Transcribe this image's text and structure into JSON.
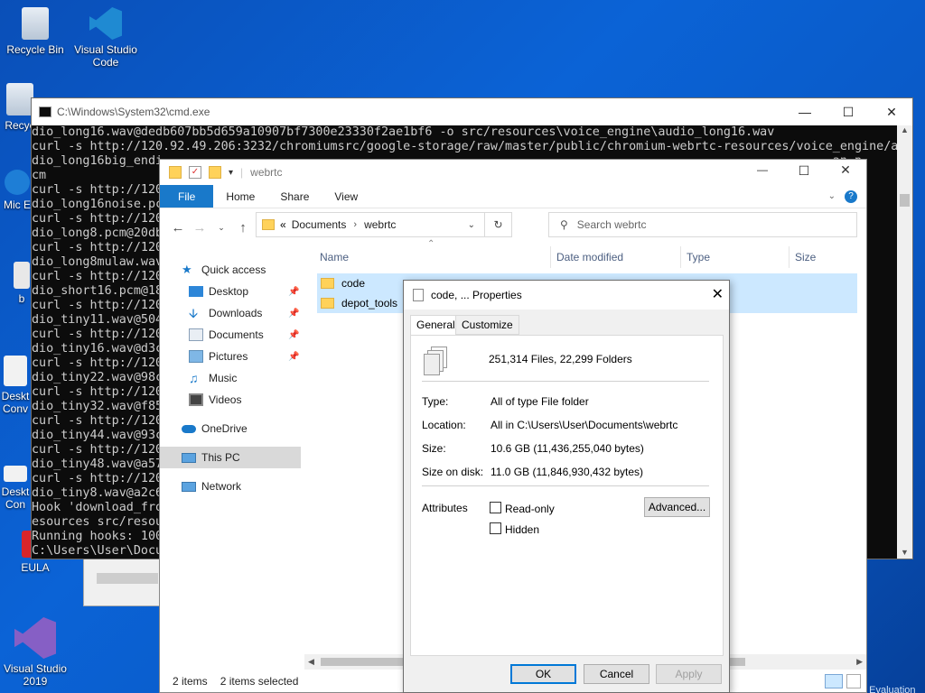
{
  "desktop": {
    "icons": [
      {
        "label": "Recycle Bin"
      },
      {
        "label": "Visual Studio Code"
      },
      {
        "label": "Recyc"
      },
      {
        "label": "Mic E"
      },
      {
        "label": "b"
      },
      {
        "label": "Deskt Conv"
      },
      {
        "label": "Deskt Con"
      },
      {
        "label": "EULA"
      },
      {
        "label": "Visual Studio 2019"
      }
    ],
    "watermark": "Windows 10 Enterprise Evaluation"
  },
  "cmd": {
    "title": "C:\\Windows\\System32\\cmd.exe",
    "lines": [
      "dio_long16.wav@dedb607bb5d659a10907bf7300e23330f2ae1bf6 -o src/resources\\voice_engine\\audio_long16.wav",
      "curl -s http://120.92.49.206:3232/chromiumsrc/google-storage/raw/master/public/chromium-webrtc-resources/voice_engine/au",
      "dio_long16big_endi                                                                                            an.p",
      "cm",
      "curl -s http://120                                                                                          e/au",
      "dio_long16noise.pc",
      "curl -s http://120                                                                                          e/au",
      "dio_long8.pcm@20db",
      "curl -s http://120                                                                                          e/au",
      "dio_long8mulaw.wav",
      "curl -s http://120                                                                                          e/au",
      "dio_short16.pcm@18",
      "curl -s http://120                                                                                          e/au",
      "dio_tiny11.wav@504",
      "curl -s http://120                                                                                          e/au",
      "dio_tiny16.wav@d3c",
      "curl -s http://120                                                                                          e/au",
      "dio_tiny22.wav@98c",
      "curl -s http://120                                                                                          e/au",
      "dio_tiny32.wav@f85",
      "curl -s http://120                                                                                          e/au",
      "dio_tiny44.wav@93c",
      "curl -s http://120                                                                                          e/au",
      "dio_tiny48.wav@a57",
      "curl -s http://120                                                                                          e/au",
      "dio_tiny8.wav@a2c6",
      "Hook 'download_fro                                                                                          tc-r",
      "esources src/resou",
      "Running hooks: 100",
      "C:\\Users\\User\\Docu"
    ]
  },
  "explorer": {
    "title": "webrtc",
    "ribbon_tabs": [
      "File",
      "Home",
      "Share",
      "View"
    ],
    "breadcrumb": [
      "Documents",
      "webrtc"
    ],
    "search_placeholder": "Search webrtc",
    "nav": {
      "quick_access": "Quick access",
      "items": [
        "Desktop",
        "Downloads",
        "Documents",
        "Pictures",
        "Music",
        "Videos"
      ],
      "onedrive": "OneDrive",
      "this_pc": "This PC",
      "network": "Network"
    },
    "columns": [
      "Name",
      "Date modified",
      "Type",
      "Size"
    ],
    "rows": [
      {
        "name": "code"
      },
      {
        "name": "depot_tools"
      }
    ],
    "status": {
      "count": "2 items",
      "selected": "2 items selected"
    }
  },
  "properties": {
    "title": "code, ... Properties",
    "tabs": [
      "General",
      "Customize"
    ],
    "summary": "251,314 Files, 22,299 Folders",
    "fields": [
      {
        "label": "Type:",
        "value": "All of type File folder"
      },
      {
        "label": "Location:",
        "value": "All in C:\\Users\\User\\Documents\\webrtc"
      },
      {
        "label": "Size:",
        "value": "10.6 GB (11,436,255,040 bytes)"
      },
      {
        "label": "Size on disk:",
        "value": "11.0 GB (11,846,930,432 bytes)"
      }
    ],
    "attributes_label": "Attributes",
    "readonly_label": "Read-only",
    "hidden_label": "Hidden",
    "advanced_label": "Advanced...",
    "ok_label": "OK",
    "cancel_label": "Cancel",
    "apply_label": "Apply"
  }
}
